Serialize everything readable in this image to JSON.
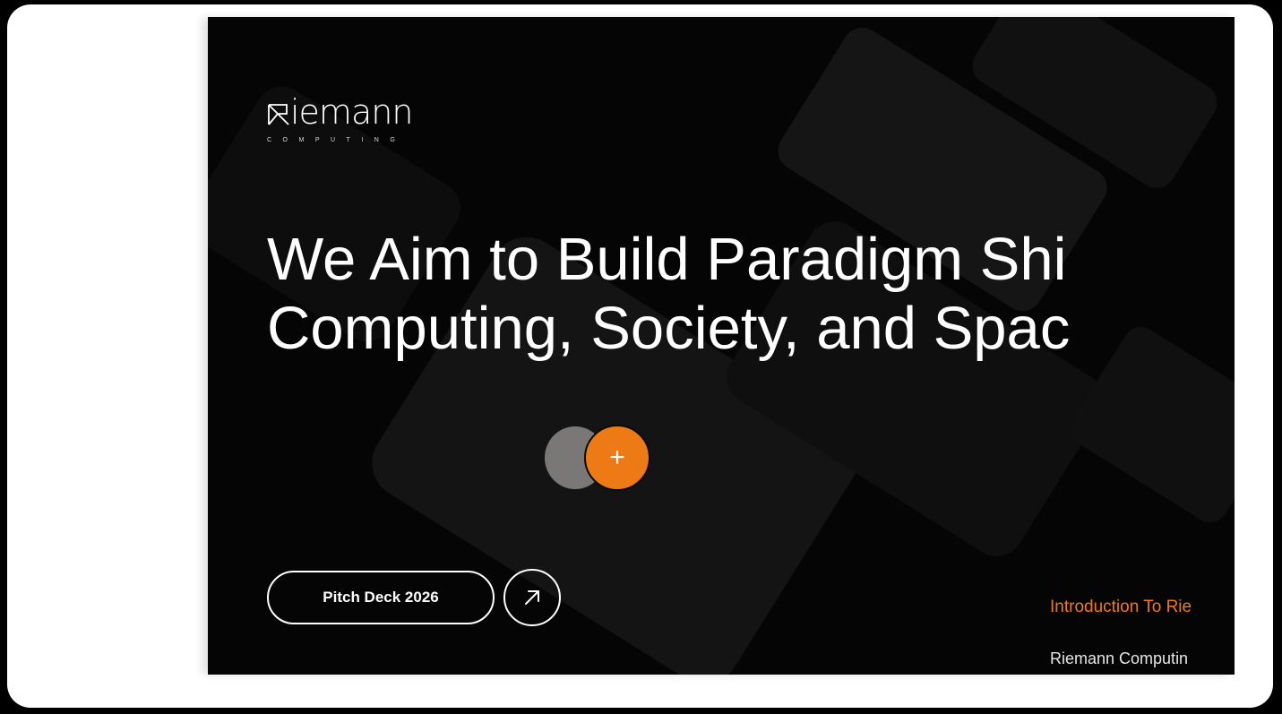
{
  "logo": {
    "wordmark": "iemann",
    "subtitle": "COMPUTING"
  },
  "hero": {
    "headline_line1": "We Aim to Build Paradigm Shi",
    "headline_line2": "Computing, Society, and Spac"
  },
  "toggle": {
    "icon": "plus-icon",
    "symbol": "+"
  },
  "actions": {
    "pitch_deck_label": "Pitch Deck 2026",
    "arrow_icon": "arrow-up-right-icon"
  },
  "footer": {
    "intro_link": "Introduction To Rie",
    "company_text": "Riemann Computin"
  },
  "colors": {
    "accent": "#ED7A14",
    "background": "#050505",
    "frame": "#FFFFFF"
  }
}
